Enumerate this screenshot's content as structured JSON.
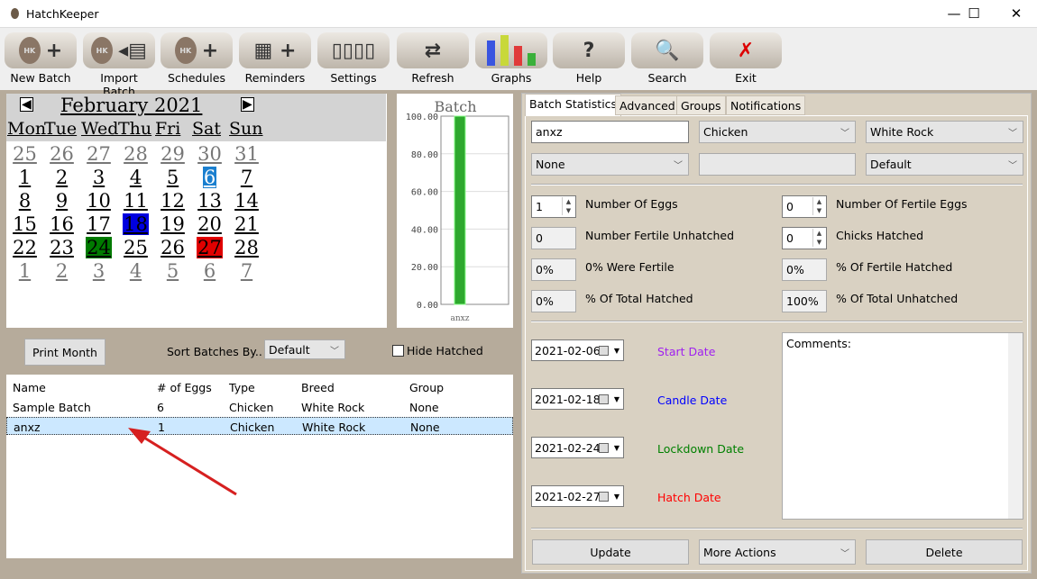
{
  "window": {
    "title": "HatchKeeper",
    "minimize": "—",
    "maximize": "☐",
    "close": "✕"
  },
  "toolbar": [
    {
      "label": "New Batch",
      "icon": "egg-plus-icon",
      "glyph": "+"
    },
    {
      "label": "Import Batch",
      "icon": "egg-import-icon",
      "glyph": "◂▤"
    },
    {
      "label": "Schedules",
      "icon": "hatched-egg-plus-icon",
      "glyph": "+"
    },
    {
      "label": "Reminders",
      "icon": "calendar-plus-icon",
      "glyph": "▦ +"
    },
    {
      "label": "Settings",
      "icon": "sliders-icon",
      "glyph": "▯▯▯▯"
    },
    {
      "label": "Refresh",
      "icon": "refresh-icon",
      "glyph": "⇄"
    },
    {
      "label": "Graphs",
      "icon": "bar-chart-icon",
      "glyph": ""
    },
    {
      "label": "Help",
      "icon": "question-icon",
      "glyph": "?"
    },
    {
      "label": "Search",
      "icon": "magnifier-icon",
      "glyph": "🔍"
    },
    {
      "label": "Exit",
      "icon": "exit-x-icon",
      "glyph": "✗"
    }
  ],
  "calendar": {
    "month": "February 2021",
    "prev": "◀",
    "next": "▶",
    "dow": [
      "Mon",
      "Tue",
      "Wed",
      "Thu",
      "Fri",
      "Sat",
      "Sun"
    ],
    "weeks": [
      [
        "25",
        "26",
        "27",
        "28",
        "29",
        "30",
        "31"
      ],
      [
        "1",
        "2",
        "3",
        "4",
        "5",
        "6",
        "7"
      ],
      [
        "8",
        "9",
        "10",
        "11",
        "12",
        "13",
        "14"
      ],
      [
        "15",
        "16",
        "17",
        "18",
        "19",
        "20",
        "21"
      ],
      [
        "22",
        "23",
        "24",
        "25",
        "26",
        "27",
        "28"
      ],
      [
        "1",
        "2",
        "3",
        "4",
        "5",
        "6",
        "7"
      ]
    ],
    "highlights": {
      "1-5": "#1a7fcf",
      "3-3": "#0000e0",
      "4-2": "#007a00",
      "4-5": "#e00000"
    }
  },
  "chart_data": {
    "type": "bar",
    "title": "Batch",
    "categories": [
      "anxz"
    ],
    "values": [
      100
    ],
    "ylim": [
      0,
      100
    ],
    "yticks": [
      "100.00",
      "80.00",
      "60.00",
      "40.00",
      "20.00",
      "0.00"
    ],
    "color": "#2ea82e",
    "grid": true
  },
  "controls": {
    "print_month": "Print Month",
    "sort_label": "Sort Batches By..",
    "sort_value": "Default",
    "hide_hatched": "Hide Hatched",
    "hide_hatched_checked": false
  },
  "batches": {
    "columns": [
      "Name",
      "# of Eggs",
      "Type",
      "Breed",
      "Group"
    ],
    "rows": [
      [
        "Sample Batch",
        "6",
        "Chicken",
        "White Rock",
        "None"
      ],
      [
        "anxz",
        "1",
        "Chicken",
        "White Rock",
        "None"
      ]
    ],
    "selected": 1
  },
  "details": {
    "tabs": [
      "Batch Statistics",
      "Advanced",
      "Groups",
      "Notifications"
    ],
    "active_tab": 0,
    "name": "anxz",
    "type": "Chicken",
    "breed": "White Rock",
    "group": "None",
    "extra": "",
    "schedule": "Default",
    "stats": [
      {
        "label": "Number Of Eggs",
        "value": "1",
        "kind": "spin"
      },
      {
        "label": "Number Of Fertile Eggs",
        "value": "0",
        "kind": "spin"
      },
      {
        "label": "Number Fertile Unhatched",
        "value": "0",
        "kind": "ro"
      },
      {
        "label": "Chicks Hatched",
        "value": "0",
        "kind": "spin"
      },
      {
        "label": "0% Were Fertile",
        "value": "0%",
        "kind": "ro"
      },
      {
        "label": "% Of Fertile Hatched",
        "value": "0%",
        "kind": "ro"
      },
      {
        "label": "% Of Total Hatched",
        "value": "0%",
        "kind": "ro"
      },
      {
        "label": "% Of Total Unhatched",
        "value": "100%",
        "kind": "ro"
      }
    ],
    "dates": [
      {
        "value": "2021-02-06",
        "label": "Start Date",
        "color": "#a020f0"
      },
      {
        "value": "2021-02-18",
        "label": "Candle Date",
        "color": "#0000ff"
      },
      {
        "value": "2021-02-24",
        "label": "Lockdown Date",
        "color": "#008000"
      },
      {
        "value": "2021-02-27",
        "label": "Hatch Date",
        "color": "#ff0000"
      }
    ],
    "comments_label": "Comments:",
    "update": "Update",
    "more_actions": "More Actions",
    "delete": "Delete"
  }
}
